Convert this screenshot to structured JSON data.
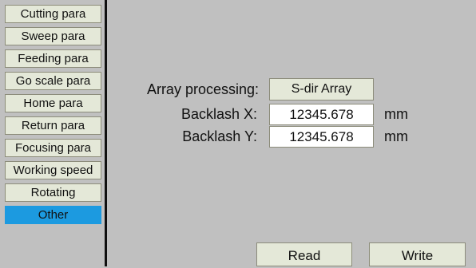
{
  "sidebar": {
    "items": [
      {
        "label": "Cutting para"
      },
      {
        "label": "Sweep para"
      },
      {
        "label": "Feeding para"
      },
      {
        "label": "Go scale para"
      },
      {
        "label": "Home para"
      },
      {
        "label": "Return para"
      },
      {
        "label": "Focusing para"
      },
      {
        "label": "Working speed"
      },
      {
        "label": "Rotating"
      },
      {
        "label": "Other"
      }
    ],
    "active_item": "Other"
  },
  "form": {
    "array_processing_label": "Array processing:",
    "array_processing_value": "S-dir Array",
    "backlash_x_label": "Backlash X:",
    "backlash_x_value": "12345.678",
    "backlash_x_unit": "mm",
    "backlash_y_label": "Backlash Y:",
    "backlash_y_value": "12345.678",
    "backlash_y_unit": "mm"
  },
  "footer": {
    "read_label": "Read",
    "write_label": "Write"
  },
  "colors": {
    "background": "#c0c0c0",
    "button": "#e4e8d8",
    "active": "#1c9ae0",
    "divider": "#101010"
  }
}
